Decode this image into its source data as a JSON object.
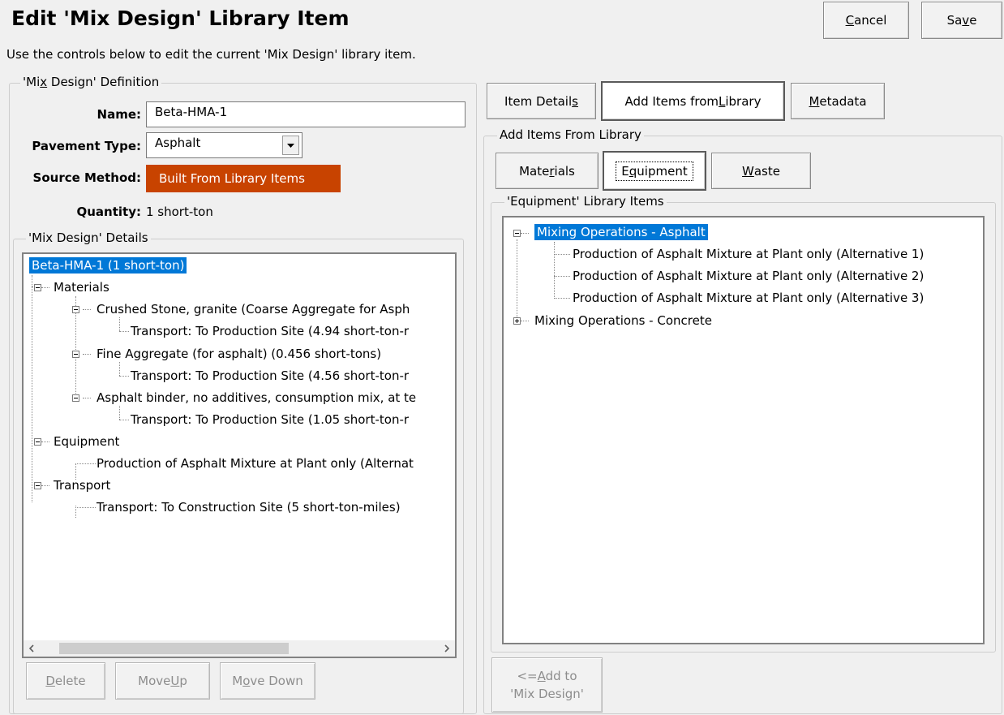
{
  "header": {
    "title": "Edit 'Mix Design' Library Item",
    "subtitle": "Use the controls below to edit the current 'Mix Design' library item.",
    "cancel": {
      "pre": "",
      "key": "C",
      "post": "ancel"
    },
    "save": {
      "pre": "Sa",
      "key": "v",
      "post": "e"
    }
  },
  "definition": {
    "legend": {
      "pre": "'Mi",
      "key": "x",
      "post": " Design' Definition"
    },
    "name_label": "Name:",
    "name_value": "Beta-HMA-1",
    "pavement_label": "Pavement Type:",
    "pavement_value": "Asphalt",
    "source_label": "Source Method:",
    "source_value": "Built From Library Items",
    "source_color": "#c84300",
    "quantity_label": "Quantity:",
    "quantity_value": "1 short-ton"
  },
  "details": {
    "legend": "'Mix Design' Details",
    "tree": {
      "root": "Beta-HMA-1 (1 short-ton)",
      "materials": "Materials",
      "m1": "Crushed Stone, granite (Coarse Aggregate for Asph",
      "m1t": "Transport: To Production Site (4.94 short-ton-r",
      "m2": "Fine Aggregate (for asphalt) (0.456 short-tons)",
      "m2t": "Transport: To Production Site (4.56 short-ton-r",
      "m3": "Asphalt binder, no additives, consumption mix, at te",
      "m3t": "Transport: To Production Site (1.05 short-ton-r",
      "equipment": "Equipment",
      "e1": "Production of Asphalt Mixture at Plant only (Alternat",
      "transport": "Transport",
      "t1": "Transport: To Construction Site (5 short-ton-miles)"
    },
    "delete": {
      "pre": "",
      "key": "D",
      "post": "elete"
    },
    "move_up": {
      "pre": "Move ",
      "key": "U",
      "post": "p"
    },
    "move_down": {
      "pre": "M",
      "key": "o",
      "post": "ve Down"
    }
  },
  "tabs": {
    "item_details": {
      "pre": "Item Detail",
      "key": "s",
      "post": ""
    },
    "add_items": {
      "pre": "Add Items from ",
      "key": "L",
      "post": "ibrary"
    },
    "metadata": {
      "pre": "",
      "key": "M",
      "post": "etadata"
    }
  },
  "library": {
    "legend": "Add Items From Library",
    "materials": {
      "pre": "Mate",
      "key": "r",
      "post": "ials"
    },
    "equipment": {
      "pre": "E",
      "key": "q",
      "post": "uipment"
    },
    "waste": {
      "pre": "",
      "key": "W",
      "post": "aste"
    },
    "items_legend": "'Equipment' Library Items",
    "tree": {
      "g1": "Mixing Operations - Asphalt",
      "i1": "Production of Asphalt Mixture at Plant only (Alternative 1)",
      "i2": "Production of Asphalt Mixture at Plant only (Alternative 2)",
      "i3": "Production of Asphalt Mixture at Plant only (Alternative 3)",
      "g2": "Mixing Operations - Concrete"
    },
    "add_line1": {
      "pre": "<=",
      "key": "A",
      "post": "dd to"
    },
    "add_line2": "'Mix Design'"
  }
}
